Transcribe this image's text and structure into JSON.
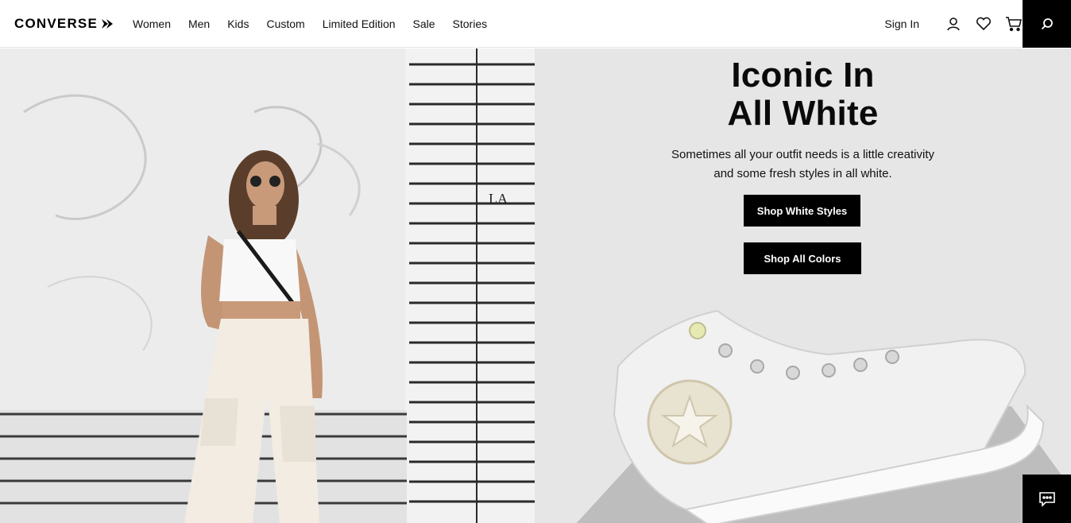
{
  "brand": {
    "logo_text": "CONVERSE"
  },
  "nav": {
    "items": [
      {
        "label": "Women"
      },
      {
        "label": "Men"
      },
      {
        "label": "Kids"
      },
      {
        "label": "Custom"
      },
      {
        "label": "Limited Edition"
      },
      {
        "label": "Sale"
      },
      {
        "label": "Stories"
      }
    ]
  },
  "account": {
    "sign_in_label": "Sign In"
  },
  "icons": {
    "user": "user-icon",
    "wishlist": "heart-icon",
    "cart": "cart-icon",
    "search": "search-icon",
    "chat": "chat-icon"
  },
  "hero": {
    "headline_line1": "Iconic In",
    "headline_line2": "All White",
    "subcopy": "Sometimes all your outfit needs is a little creativity and some fresh styles in all white.",
    "cta_primary": "Shop White Styles",
    "cta_secondary": "Shop All Colors",
    "wall_sign": "LA"
  },
  "colors": {
    "accent": "#000000",
    "panel_bg": "#e6e6e6"
  }
}
